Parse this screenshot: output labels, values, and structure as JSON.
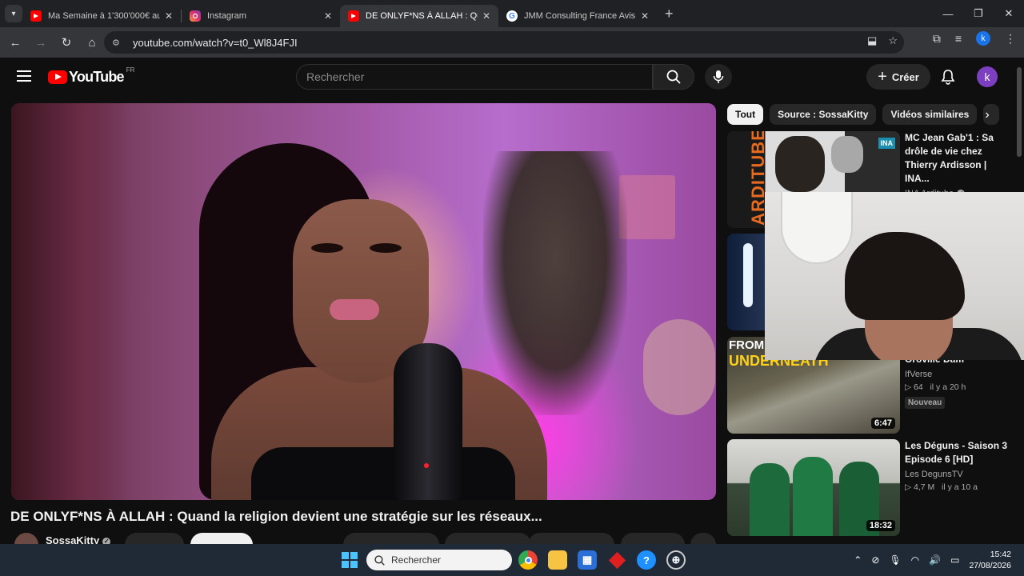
{
  "browser": {
    "tabs": [
      {
        "title": "Ma Semaine à 1'300'000€ au Gr",
        "icon": "youtube-icon",
        "active": false
      },
      {
        "title": "Instagram",
        "icon": "instagram-icon",
        "active": false
      },
      {
        "title": "DE ONLYF*NS À ALLAH : Quanc",
        "icon": "youtube-icon",
        "active": true
      },
      {
        "title": "JMM Consulting France Avis - R",
        "icon": "google-icon",
        "active": false
      }
    ],
    "url": "youtube.com/watch?v=t0_Wl8J4FJI",
    "profile_letter": "k"
  },
  "youtube": {
    "logo_text": "YouTube",
    "country_code": "FR",
    "search_placeholder": "Rechercher",
    "create_label": "Créer",
    "avatar_letter": "k"
  },
  "video": {
    "title": "DE ONLYF*NS À ALLAH : Quand la religion devient une stratégie sur les réseaux...",
    "channel": "SossaKitty"
  },
  "chips": [
    "Tout",
    "Source : SossaKitty",
    "Vidéos similaires"
  ],
  "recommendations": [
    {
      "title": "MC Jean Gab'1 : Sa drôle de vie chez Thierry Ardisson | INA...",
      "channel": "INA Arditube",
      "verified": true,
      "meta": "",
      "duration": "",
      "thumb_text": "ARDITUBE",
      "badge": "INA"
    },
    {
      "title": "",
      "channel": "",
      "verified": false,
      "meta": "",
      "duration": "",
      "thumb_text": "",
      "badge": ""
    },
    {
      "title": "Oroville Dam",
      "channel": "IfVerse",
      "verified": false,
      "views": "64",
      "age": "il y a 20 h",
      "duration": "6:47",
      "thumb_text": "UNDERNEATH",
      "thumb_text_top": "FROM",
      "new_badge": "Nouveau"
    },
    {
      "title": "Les Déguns - Saison 3 Episode 6 [HD]",
      "channel": "Les DegunsTV",
      "verified": false,
      "views": "4,7 M",
      "age": "il y a 10 a",
      "duration": "18:32"
    }
  ],
  "taskbar": {
    "search_placeholder": "Rechercher",
    "time": "15:42",
    "date": "27/08/2026"
  },
  "colors": {
    "youtube_red": "#ff0000",
    "background": "#0f0f0f",
    "avatar_purple": "#7b3fbf",
    "taskbar": "#1f2a36"
  }
}
